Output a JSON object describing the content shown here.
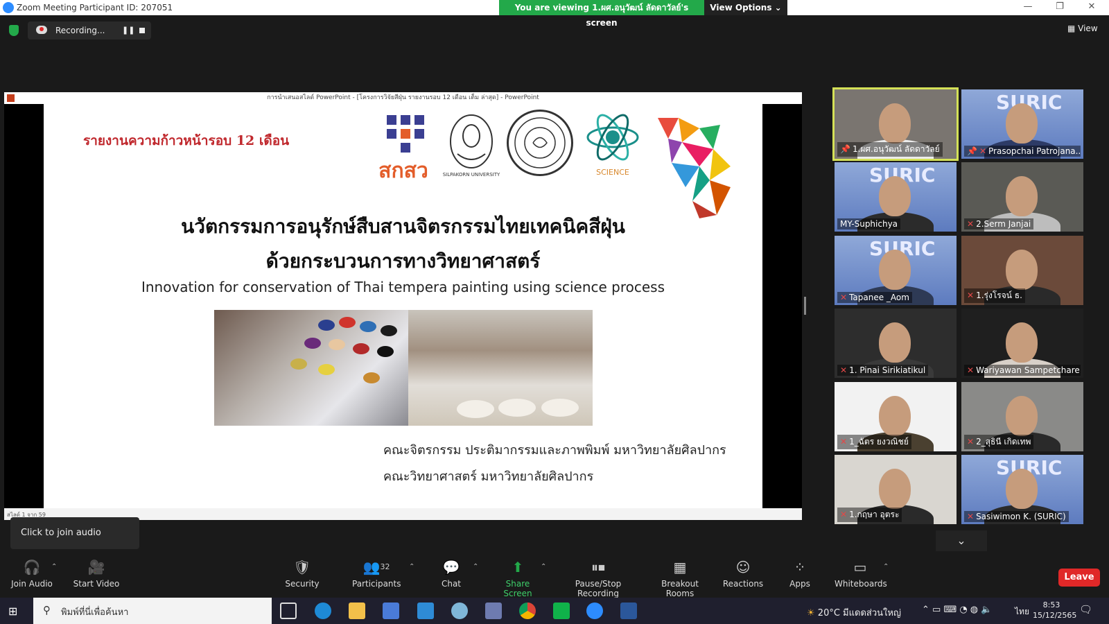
{
  "window": {
    "title": "Zoom Meeting Participant ID: 207051",
    "viewing_banner": "You are viewing 1.ผศ.อนุวัฒน์ ลัดดาวัลย์'s screen",
    "view_options": "View Options ⌄"
  },
  "topbar": {
    "recording_label": "Recording...",
    "pause_glyph": "❚❚",
    "view_label": "View"
  },
  "shared_screen": {
    "ppt_title": "การนำเสนอสไลด์ PowerPoint - [โครงการวิจัยสีฝุ่น รายงานรอบ 12 เดือน เต็ม ล่าสุด] - PowerPoint",
    "status": "สไลด์ 1 จาก 59",
    "slide": {
      "header": "รายงานความก้าวหน้ารอบ 12 เดือน",
      "tsri_text": "สกสว",
      "su_text": "SILPAKORN UNIVERSITY",
      "science_text": "SCIENCE",
      "title_line1": "นวัตกรรมการอนุรักษ์สืบสานจิตรกรรมไทยเทคนิคสีฝุ่น",
      "title_line2": "ด้วยกระบวนการทางวิทยาศาสตร์",
      "title_en": "Innovation for conservation of Thai tempera painting using science process",
      "footer_line1": "คณะจิตรกรรม ประติมากรรมและภาพพิมพ์ มหาวิทยาลัยศิลปากร",
      "footer_line2": "คณะวิทยาศาสตร์ มหาวิทยาลัยศิลปากร"
    }
  },
  "participants": [
    {
      "name": "1.ผศ.อนุวัฒน์ ลัดดาวัลย์",
      "muted": false,
      "pinned": true,
      "suric": false,
      "bg": "#7a7570",
      "shirt": "#ececec"
    },
    {
      "name": "Prasopchai Patrojana...",
      "muted": true,
      "pinned": true,
      "suric": true,
      "bg": "",
      "shirt": "#2d3b66"
    },
    {
      "name": "MY-Suphichya",
      "muted": false,
      "pinned": false,
      "suric": true,
      "bg": "",
      "shirt": "#2b2b2b"
    },
    {
      "name": "2.Serm Janjai",
      "muted": true,
      "pinned": false,
      "suric": false,
      "bg": "#5a5a55",
      "shirt": "#bdbdbd"
    },
    {
      "name": "Tapanee _Aom",
      "muted": true,
      "pinned": false,
      "suric": true,
      "bg": "",
      "shirt": "#2e3a55"
    },
    {
      "name": "1.รุ่งโรจน์ ธ.",
      "muted": true,
      "pinned": false,
      "suric": false,
      "bg": "#6b4a3a",
      "shirt": "#2a2a2a"
    },
    {
      "name": "1. Pinai Sirikiatikul",
      "muted": true,
      "pinned": false,
      "suric": false,
      "bg": "#2d2d2d",
      "shirt": "#3a3a3a"
    },
    {
      "name": "Wariyawan Sampetchare...",
      "muted": true,
      "pinned": false,
      "suric": false,
      "bg": "#1f1f1f",
      "shirt": "#d8d0c8"
    },
    {
      "name": "1_ฉัตร ยงวณิชย์",
      "muted": true,
      "pinned": false,
      "suric": false,
      "bg": "#f2f2f2",
      "shirt": "#4a4030"
    },
    {
      "name": "2_สุธินี เกิดเทพ",
      "muted": true,
      "pinned": false,
      "suric": false,
      "bg": "#8a8a88",
      "shirt": "#2a2a2a"
    },
    {
      "name": "1.กฤษา อุตระ",
      "muted": true,
      "pinned": false,
      "suric": false,
      "bg": "#d9d6d0",
      "shirt": "#2a2a2a"
    },
    {
      "name": "Sasiwimon K. (SURIC)",
      "muted": true,
      "pinned": false,
      "suric": true,
      "bg": "",
      "shirt": "#2a2a2a"
    }
  ],
  "suric_label": "SURIC",
  "tiles_more": "⌄",
  "audio_tooltip": "Click to join audio",
  "toolbar": {
    "join_audio": "Join Audio",
    "start_video": "Start Video",
    "security": "Security",
    "participants": "Participants",
    "participants_count": "32",
    "chat": "Chat",
    "share_screen": "Share Screen",
    "pause_stop_recording": "Pause/Stop Recording",
    "breakout_rooms": "Breakout Rooms",
    "reactions": "Reactions",
    "apps": "Apps",
    "whiteboards": "Whiteboards",
    "leave": "Leave"
  },
  "taskbar": {
    "search_placeholder": "พิมพ์ที่นี่เพื่อค้นหา",
    "weather": "20°C มีแดดส่วนใหญ่",
    "lang": "ไทย",
    "time": "8:53",
    "date": "15/12/2565"
  },
  "colors": {
    "banner_green": "#23a94a",
    "leave_red": "#e02828",
    "slide_header_red": "#c0282d",
    "active_speaker": "#d4e157"
  }
}
